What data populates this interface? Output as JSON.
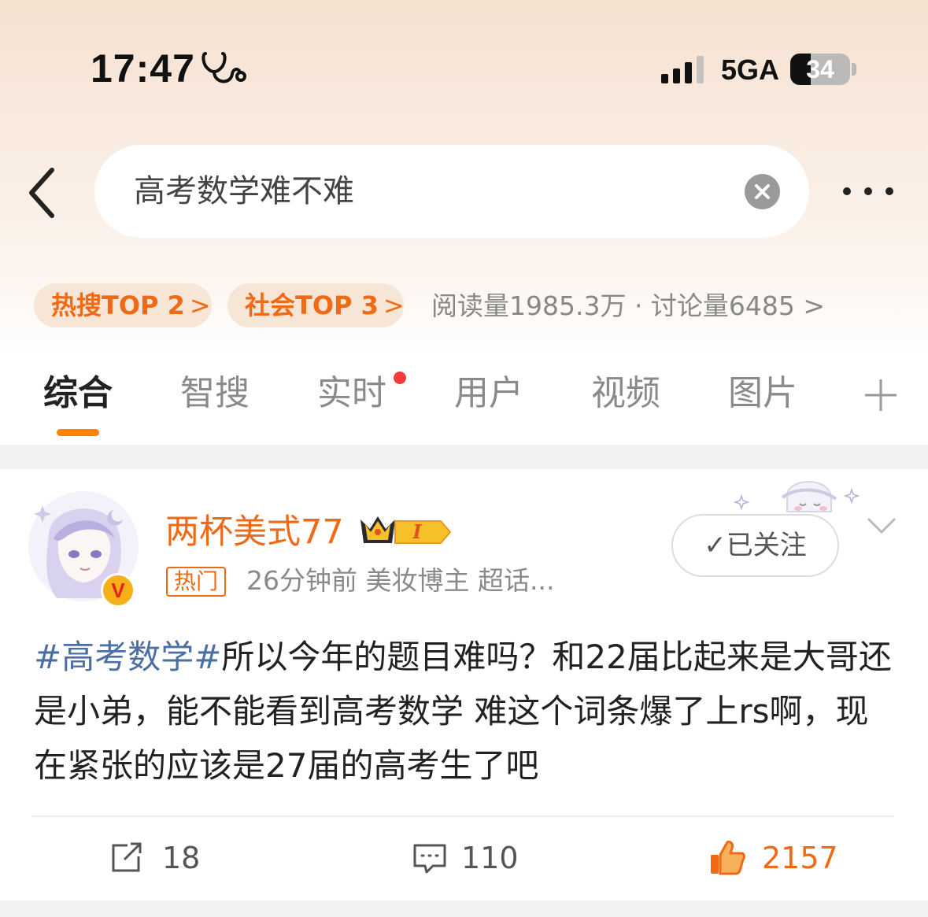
{
  "status_bar": {
    "time": "17:47",
    "network": "5GA",
    "battery": "34",
    "battery_level": 0.34
  },
  "search": {
    "query": "高考数学难不难"
  },
  "hot_tags": [
    {
      "label": "热搜TOP 2",
      "arrow": ">"
    },
    {
      "label": "社会TOP 3",
      "arrow": ">"
    }
  ],
  "stats": "阅读量1985.3万 · 讨论量6485 >",
  "tabs": [
    {
      "label": "综合",
      "active": true
    },
    {
      "label": "智搜"
    },
    {
      "label": "实时",
      "has_dot": true
    },
    {
      "label": "用户"
    },
    {
      "label": "视频"
    },
    {
      "label": "图片"
    }
  ],
  "post": {
    "username": "两杯美式77",
    "crown_level": "I",
    "verified_mark": "V",
    "hot_badge": "热门",
    "meta": "26分钟前  美妆博主 超话...",
    "follow_label": "✓已关注",
    "hashtag": "#高考数学#",
    "body": "所以今年的题目难吗？和22届比起来是大哥还是小弟，能不能看到高考数学 难这个词条爆了上rs啊，现在紧张的应该是27届的高考生了吧",
    "actions": {
      "share_count": "18",
      "comment_count": "110",
      "like_count": "2157"
    }
  },
  "colors": {
    "accent": "#f06a15",
    "tab_indicator": "#ff8200",
    "hashtag": "#4a6fa5",
    "notification_dot": "#f53b3b"
  },
  "icons": [
    "focus-stethoscope-icon",
    "signal-icon",
    "battery-icon",
    "back-arrow-icon",
    "clear-icon",
    "more-icon",
    "plus-icon",
    "crown-icon",
    "chevron-down-icon",
    "share-icon",
    "comment-icon",
    "like-icon"
  ]
}
